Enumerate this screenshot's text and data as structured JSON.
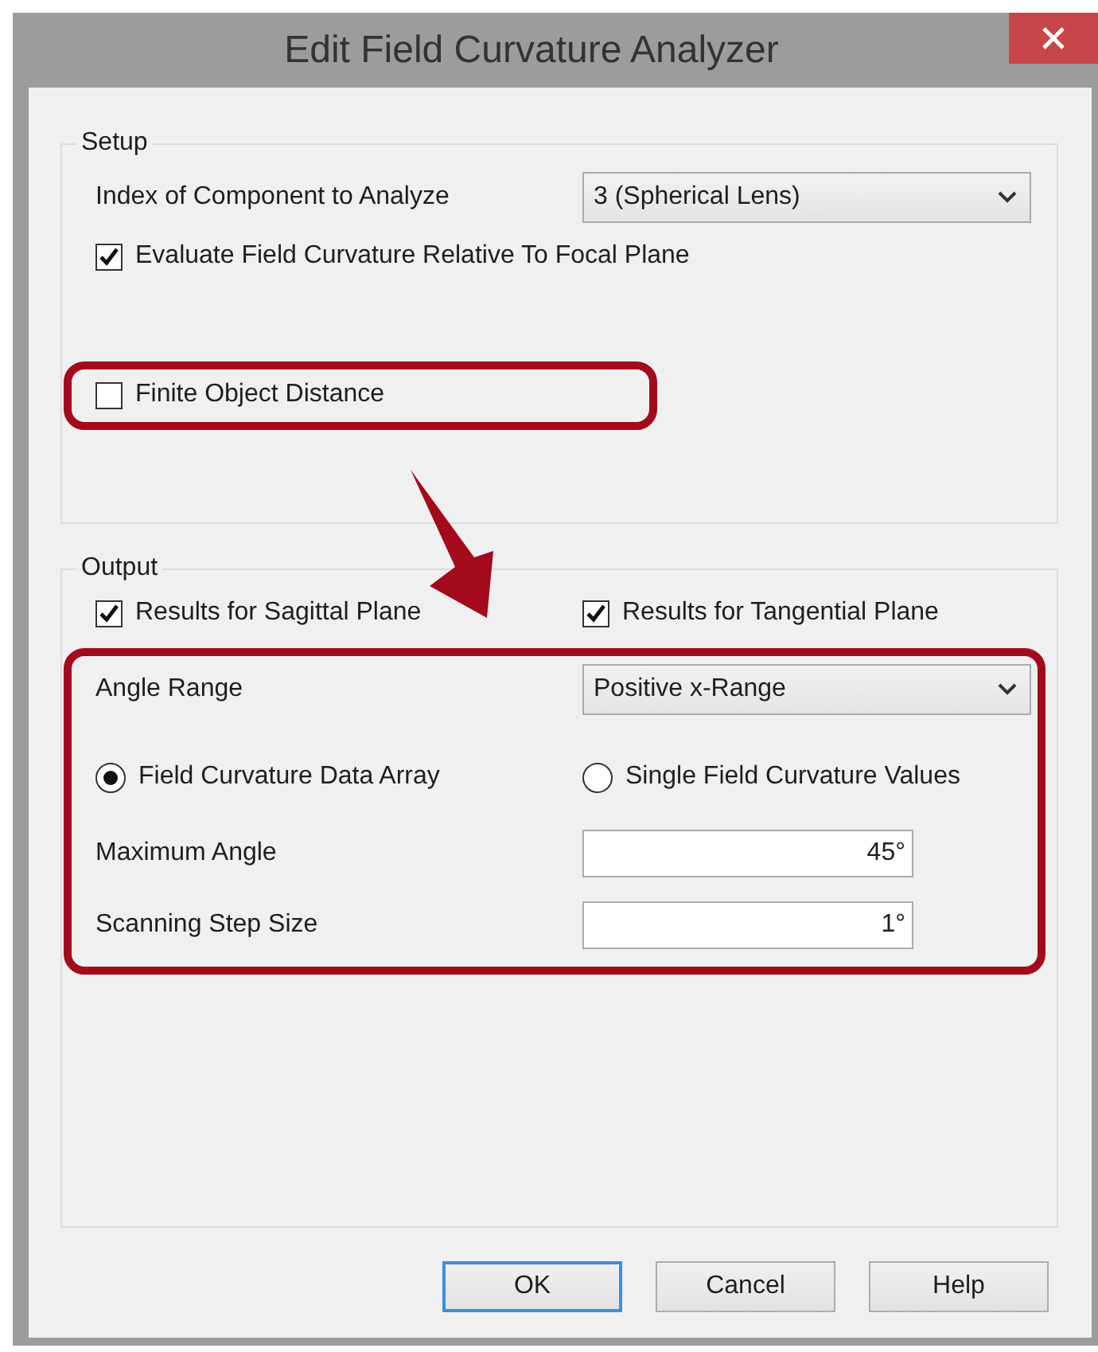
{
  "window": {
    "title": "Edit Field Curvature Analyzer"
  },
  "setup": {
    "title": "Setup",
    "component": {
      "label": "Index of Component to Analyze",
      "value": "3 (Spherical Lens)"
    },
    "relative_to_focal_plane": {
      "label": "Evaluate Field Curvature Relative To Focal Plane",
      "checked": true
    },
    "finite_object_distance": {
      "label": "Finite Object Distance",
      "checked": false
    }
  },
  "output": {
    "title": "Output",
    "sagittal": {
      "label": "Results for Sagittal Plane",
      "checked": true
    },
    "tangential": {
      "label": "Results for Tangential Plane",
      "checked": true
    },
    "angle_range": {
      "label": "Angle Range",
      "value": "Positive x-Range"
    },
    "modes": [
      {
        "label": "Field Curvature Data Array",
        "selected": true
      },
      {
        "label": "Single Field Curvature Values",
        "selected": false
      }
    ],
    "maximum_angle": {
      "label": "Maximum Angle",
      "value": "45°"
    },
    "scanning_step_size": {
      "label": "Scanning Step Size",
      "value": "1°"
    }
  },
  "buttons": [
    {
      "label": "OK",
      "default": true
    },
    {
      "label": "Cancel",
      "default": false
    },
    {
      "label": "Help",
      "default": false
    }
  ]
}
